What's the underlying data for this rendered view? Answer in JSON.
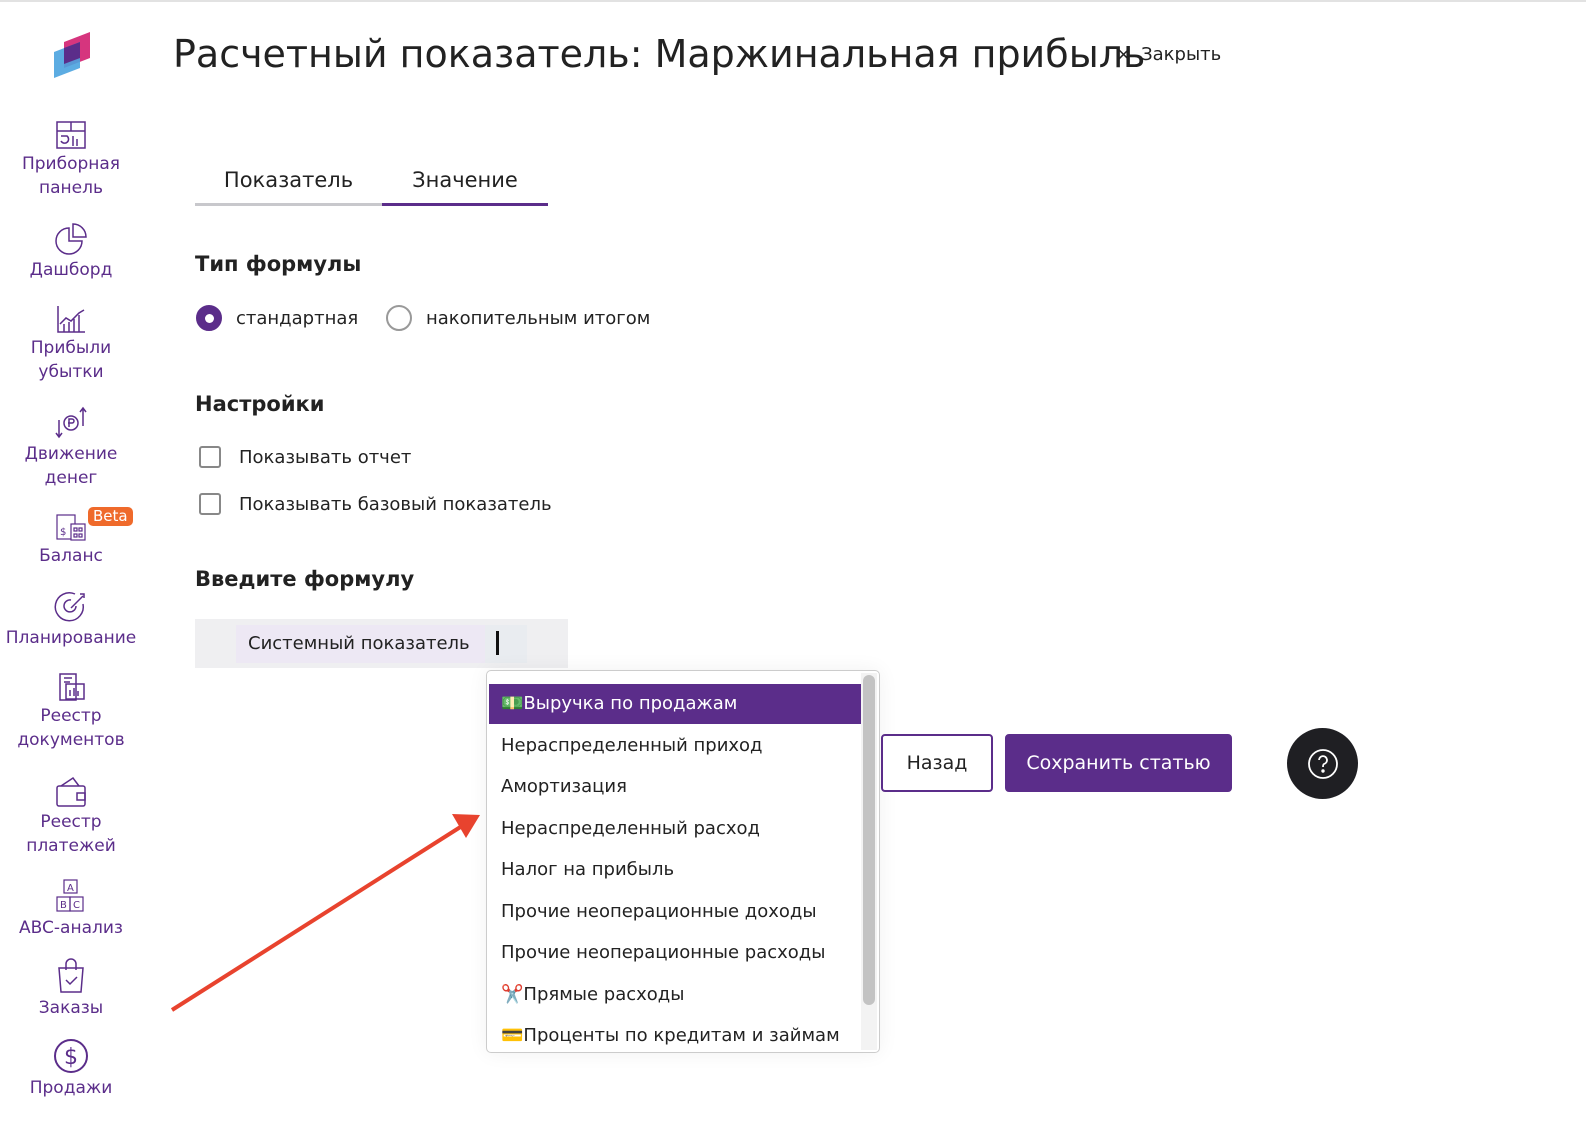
{
  "header": {
    "title": "Расчетный показатель: Маржинальная прибыль",
    "close_label": "Закрыть"
  },
  "sidebar": {
    "items": [
      {
        "label1": "Приборная",
        "label2": "панель"
      },
      {
        "label1": "Дашборд"
      },
      {
        "label1": "Прибыли",
        "label2": "убытки"
      },
      {
        "label1": "Движение",
        "label2": "денег"
      },
      {
        "label1": "Баланс",
        "badge": "Beta"
      },
      {
        "label1": "Планирование"
      },
      {
        "label1": "Реестр",
        "label2": "документов"
      },
      {
        "label1": "Реестр",
        "label2": "платежей"
      },
      {
        "label1": "ABC-анализ"
      },
      {
        "label1": "Заказы"
      },
      {
        "label1": "Продажи"
      }
    ]
  },
  "tabs": [
    {
      "label": "Показатель"
    },
    {
      "label": "Значение",
      "active": true
    }
  ],
  "formula_type": {
    "heading": "Тип формулы",
    "options": [
      {
        "label": "стандартная",
        "selected": true
      },
      {
        "label": "накопительным итогом",
        "selected": false
      }
    ]
  },
  "settings": {
    "heading": "Настройки",
    "options": [
      {
        "label": "Показывать отчет",
        "checked": false
      },
      {
        "label": "Показывать базовый показатель",
        "checked": false
      }
    ]
  },
  "formula": {
    "heading": "Введите формулу",
    "chip": "Системный показатель"
  },
  "dropdown": {
    "items": [
      {
        "label": "💵Выручка по продажам",
        "selected": true
      },
      {
        "label": "Нераспределенный приход"
      },
      {
        "label": "Амортизация"
      },
      {
        "label": "Нераспределенный расход"
      },
      {
        "label": "Налог на прибыль"
      },
      {
        "label": "Прочие неоперационные доходы"
      },
      {
        "label": "Прочие неоперационные расходы"
      },
      {
        "label": "✂️Прямые расходы"
      },
      {
        "label": "💳Проценты по кредитам и займам"
      }
    ]
  },
  "buttons": {
    "back": "Назад",
    "save": "Сохранить статью"
  },
  "colors": {
    "accent": "#5b2d8a",
    "beta": "#ef6a2b",
    "arrow": "#e8432e"
  }
}
